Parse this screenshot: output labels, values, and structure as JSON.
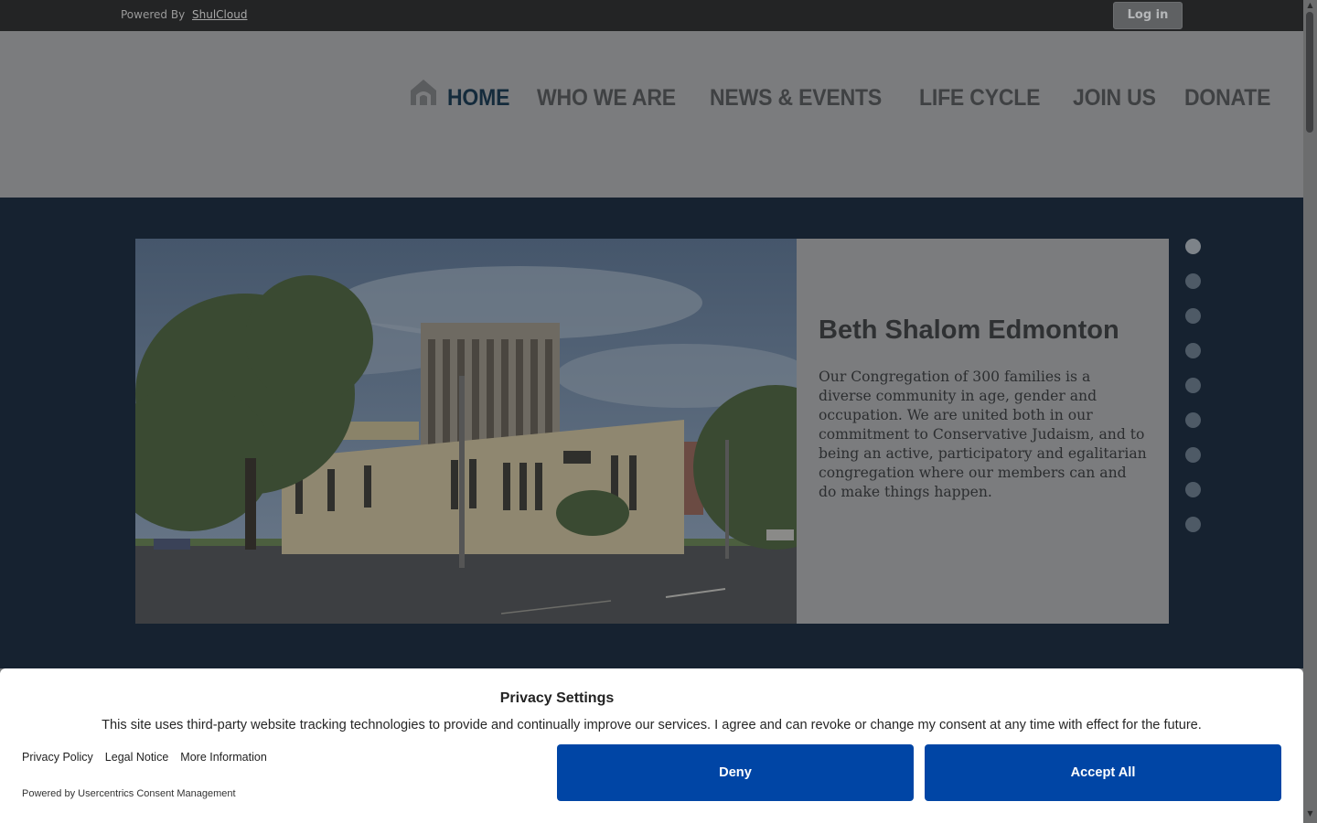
{
  "topbar": {
    "powered_prefix": "Powered By",
    "powered_link": "ShulCloud",
    "login_label": "Log in"
  },
  "nav": {
    "items": [
      {
        "label": "HOME",
        "active": true
      },
      {
        "label": "WHO WE ARE"
      },
      {
        "label": "NEWS & EVENTS"
      },
      {
        "label": "LIFE CYCLE"
      },
      {
        "label": "JOIN US"
      },
      {
        "label": "DONATE"
      }
    ],
    "home_icon": "synagogue-home-icon"
  },
  "slide": {
    "title": "Beth Shalom Edmonton",
    "body": "Our Congregation of 300 families is a diverse community in age, gender and occupation. We are united both in our commitment to Conservative Judaism, and to being an active, participatory and egalitarian congregation where our members can and do make things happen.",
    "dot_count": 9,
    "active_dot": 0
  },
  "consent": {
    "title": "Privacy Settings",
    "text": "This site uses third-party website tracking technologies to provide and continually improve our services. I agree and can revoke or change my consent at any time with effect for the future.",
    "links": [
      "Privacy Policy",
      "Legal Notice",
      "More Information"
    ],
    "powered": "Powered by Usercentrics Consent Management",
    "deny_label": "Deny",
    "accept_label": "Accept All"
  },
  "colors": {
    "accent_button": "#0045a5",
    "band": "#162230",
    "topbar": "#232425"
  }
}
